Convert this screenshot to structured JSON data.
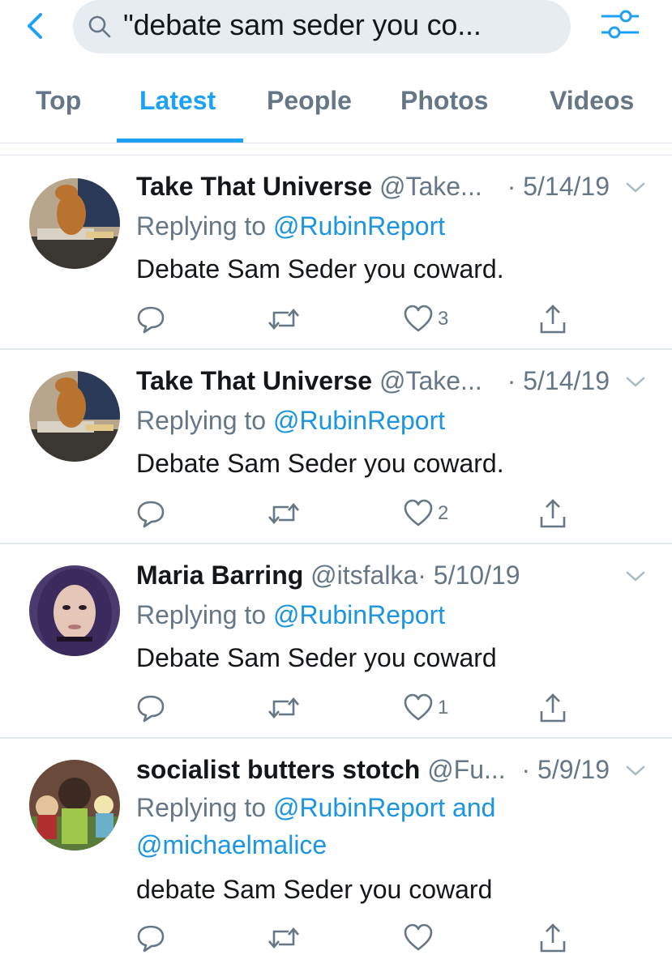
{
  "search": {
    "query": "\"debate sam seder you co..."
  },
  "tabs": [
    {
      "label": "Top"
    },
    {
      "label": "Latest"
    },
    {
      "label": "People"
    },
    {
      "label": "Photos"
    },
    {
      "label": "Videos"
    }
  ],
  "tweets": [
    {
      "name": "Take That Universe",
      "handle": "@Take...",
      "date": "· 5/14/19",
      "reply_prefix": "Replying to ",
      "reply_to": "@RubinReport",
      "reply_to_2": "",
      "text": "Debate Sam Seder you coward.",
      "likes": "3"
    },
    {
      "name": "Take That Universe",
      "handle": "@Take...",
      "date": "· 5/14/19",
      "reply_prefix": "Replying to ",
      "reply_to": "@RubinReport",
      "reply_to_2": "",
      "text": "Debate Sam Seder you coward.",
      "likes": "2"
    },
    {
      "name": "Maria Barring",
      "handle": "@itsfalka",
      "date": "· 5/10/19",
      "reply_prefix": "Replying to ",
      "reply_to": "@RubinReport",
      "reply_to_2": "",
      "text": "Debate Sam Seder you coward",
      "likes": "1"
    },
    {
      "name": "socialist butters stotch",
      "handle": "@Fu...",
      "date": "· 5/9/19",
      "reply_prefix": "Replying to ",
      "reply_to": "@RubinReport and",
      "reply_to_2": "@michaelmalice",
      "text": "debate Sam Seder you coward",
      "likes": ""
    }
  ],
  "colors": {
    "accent": "#1da1f2",
    "link": "#1b95e0",
    "secondary_text": "#657786",
    "primary_text": "#14171a"
  }
}
